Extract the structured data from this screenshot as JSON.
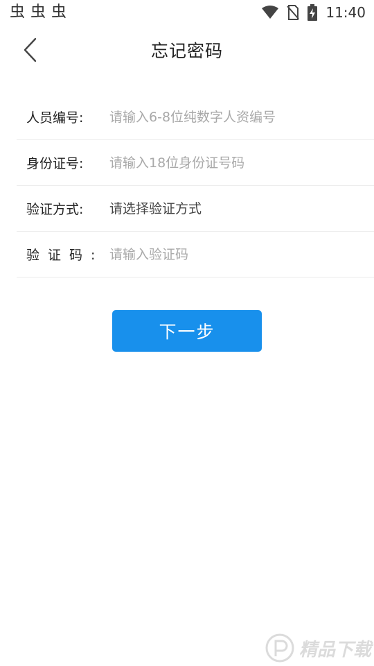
{
  "status_bar": {
    "left_icons": [
      "bug-icon",
      "bug-icon",
      "bug-icon"
    ],
    "bug_glyph": "虫",
    "time": "11:40"
  },
  "nav": {
    "title": "忘记密码",
    "back_icon": "chevron-left-icon"
  },
  "form": {
    "employee_id": {
      "label": "人员编号:",
      "placeholder": "请输入6-8位纯数字人资编号",
      "value": ""
    },
    "id_number": {
      "label": "身份证号:",
      "placeholder": "请输入18位身份证号码",
      "value": ""
    },
    "verify_method": {
      "label": "验证方式:",
      "placeholder": "请选择验证方式"
    },
    "verify_code": {
      "label": "验证码:",
      "placeholder": "请输入验证码",
      "value": ""
    }
  },
  "next_button": {
    "label": "下一步"
  },
  "colors": {
    "primary": "#1890ec",
    "placeholder": "#a9a9a9",
    "divider": "#ececec"
  }
}
